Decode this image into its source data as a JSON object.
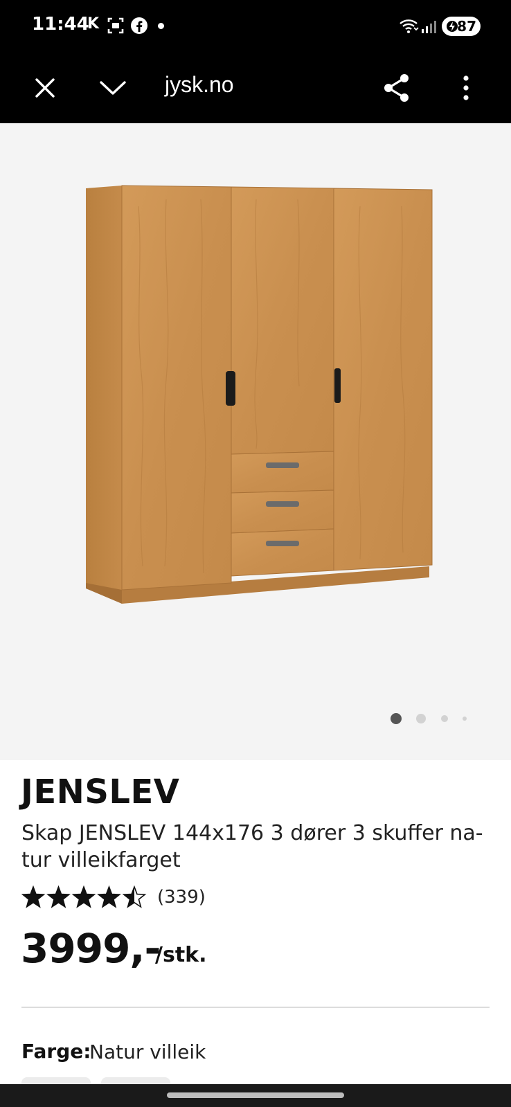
{
  "status_bar": {
    "time": "11:44",
    "carrier_letter": "K",
    "battery": "87",
    "icons": [
      "screenshot-icon",
      "facebook-icon",
      "notification-dot",
      "wifi-icon",
      "signal-icon",
      "battery-icon"
    ]
  },
  "browser": {
    "url": "jysk.no",
    "icons": [
      "close-icon",
      "chevron-down-icon",
      "share-icon",
      "more-vert-icon"
    ]
  },
  "product": {
    "brand": "JENSLEV",
    "subtitle": "Skap JENSLEV 144x176 3 dører 3 skuffer na-tur villeikfarget",
    "rating_value": 4.5,
    "rating_max": 5,
    "rating_count": "(339)",
    "price": "3999,-",
    "unit": "/stk.",
    "color_label": "Farge:",
    "color_value": "Natur villeik"
  },
  "carousel": {
    "pages": 4,
    "active_index": 0
  },
  "colors": {
    "status_bg": "#000000",
    "image_bg": "#f4f4f4",
    "wood": "#c98f4f"
  }
}
